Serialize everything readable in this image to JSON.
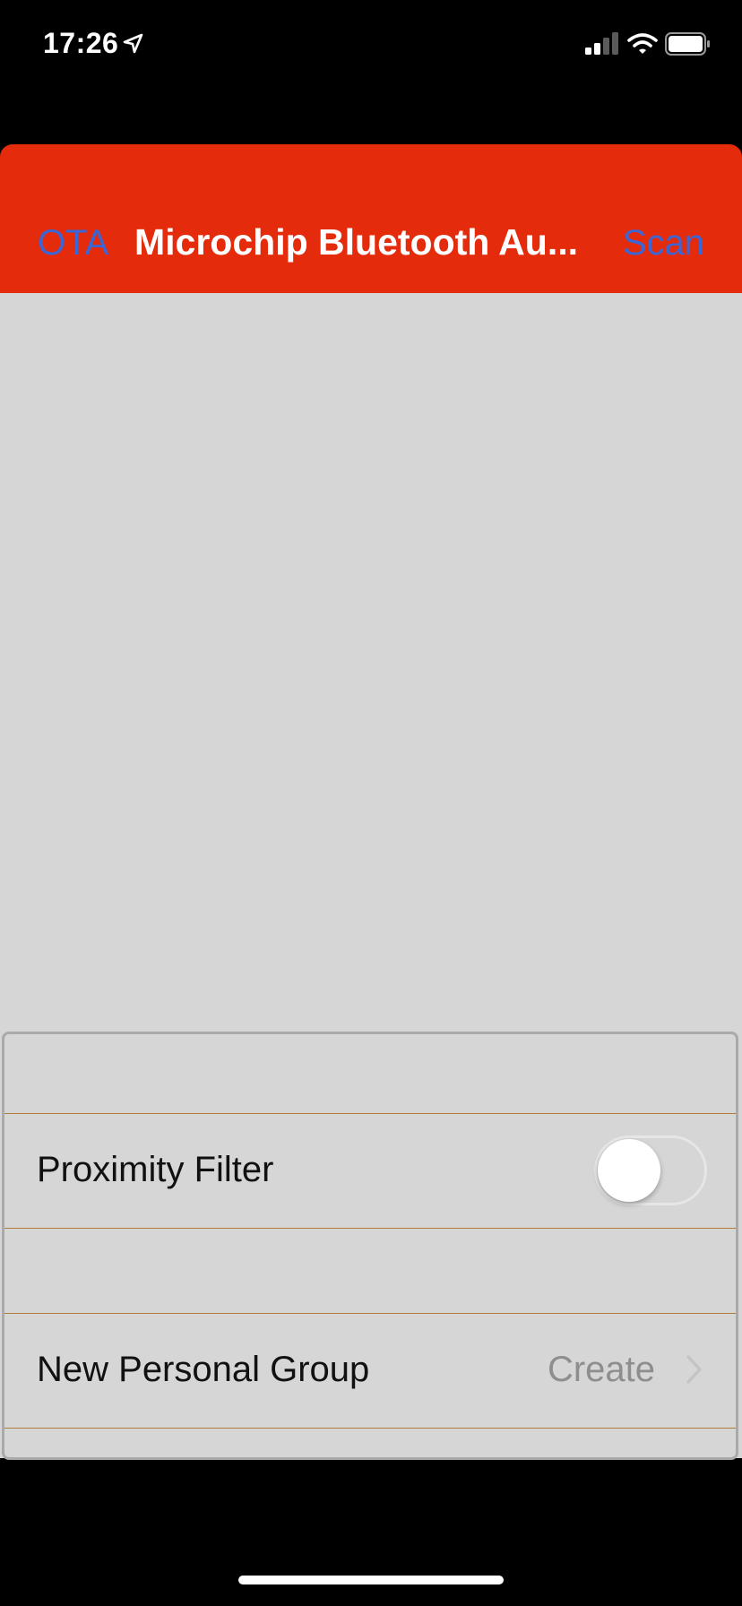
{
  "status_bar": {
    "time": "17:26",
    "icons": [
      "location-arrow-icon",
      "cellular-signal-icon",
      "wifi-icon",
      "battery-icon"
    ]
  },
  "nav": {
    "left_button": "OTA",
    "title": "Microchip Bluetooth Au...",
    "right_button": "Scan",
    "background_color": "#e42b0b",
    "button_color": "#3a66d6"
  },
  "settings": {
    "proximity_filter": {
      "label": "Proximity Filter",
      "enabled": false
    },
    "new_personal_group": {
      "label": "New Personal Group",
      "detail": "Create",
      "icon": "chevron-right-icon"
    }
  }
}
